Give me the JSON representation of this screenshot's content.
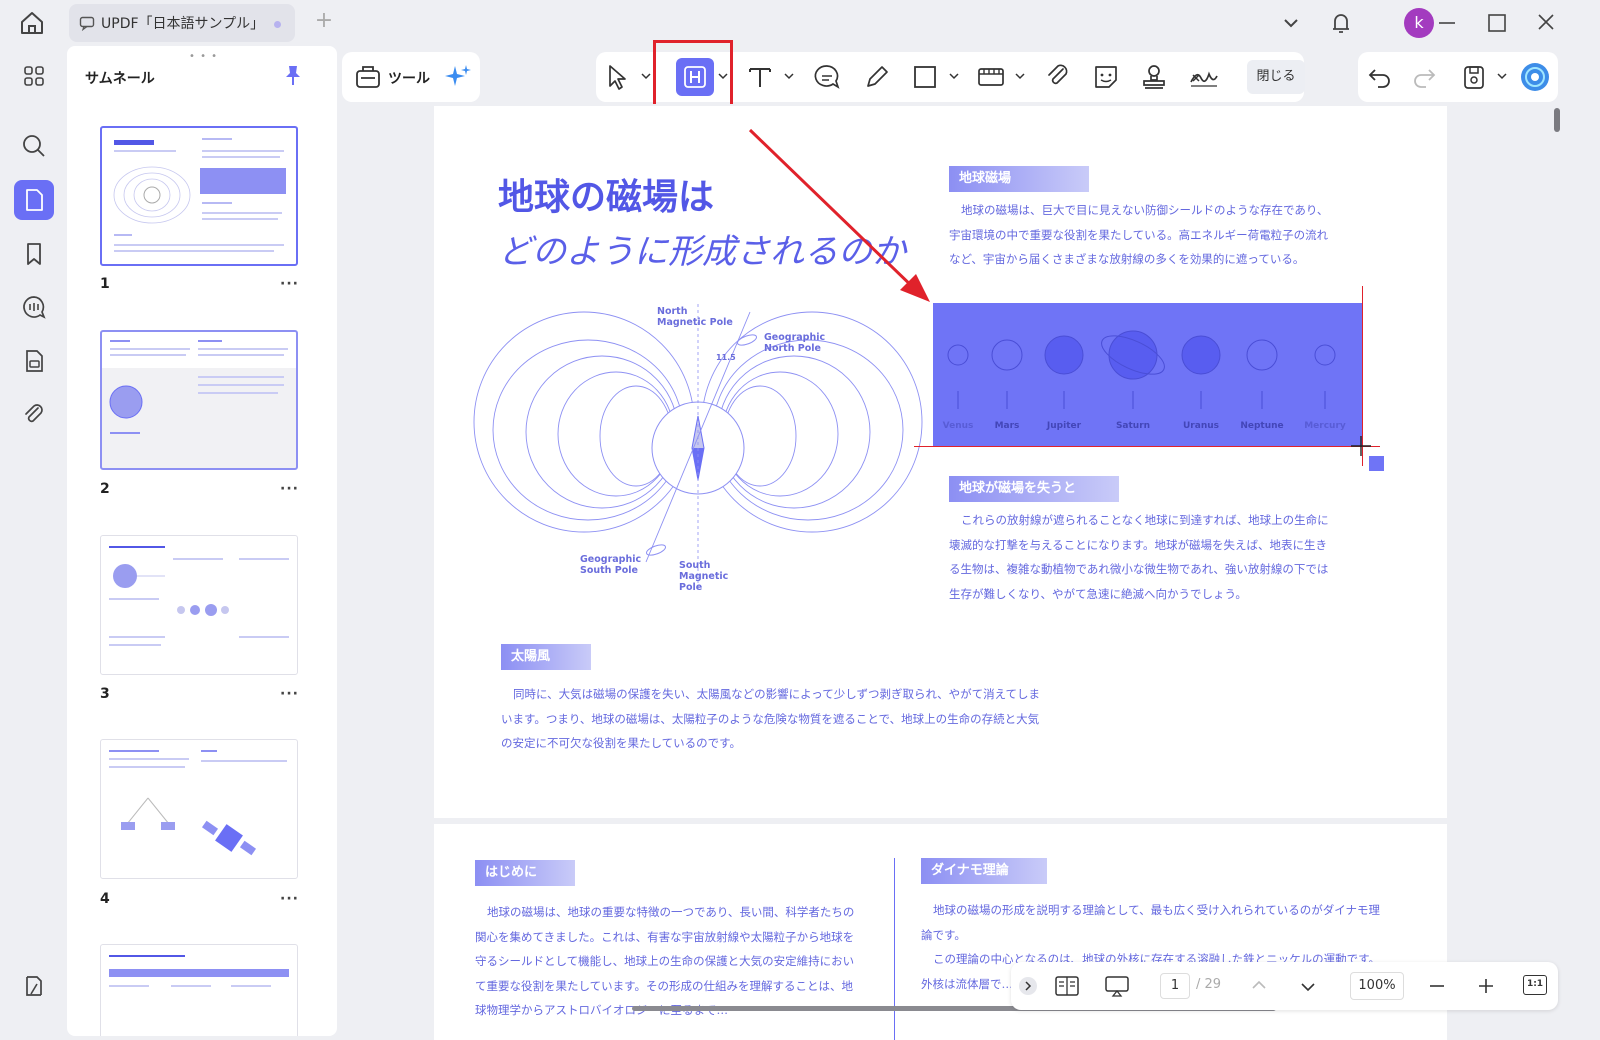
{
  "window": {
    "tab_title": "UPDF「日本語サンプル」",
    "new_tab": "+",
    "avatar_initial": "k"
  },
  "thumbnails": {
    "title": "サムネール",
    "grip": "• • •",
    "more": "···",
    "pages": [
      {
        "number": "1"
      },
      {
        "number": "2"
      },
      {
        "number": "3"
      },
      {
        "number": "4"
      }
    ]
  },
  "toolbar": {
    "tools_label": "ツール",
    "close_label": "閉じる",
    "active_tool": "highlight-area",
    "accent_color": "#6a6ff5",
    "annotation_color": "#e0222b"
  },
  "document": {
    "title_line1": "地球の磁場は",
    "title_line2": "どのように形成されるのか",
    "section1": {
      "heading": "地球磁場",
      "lines": [
        "地球の磁場は、巨大で目に見えない防御シールドのような存在であり、",
        "宇宙環境の中で重要な役割を果たしている。高エネルギー荷電粒子の流れ",
        "など、宇宙から届くさまざまな放射線の多くを効果的に遮っている。"
      ]
    },
    "section2": {
      "heading": "地球が磁場を失うと",
      "lines": [
        "これらの放射線が遮られることなく地球に到達すれば、地球上の生命に",
        "壊滅的な打撃を与えることになります。地球が磁場を失えば、地表に生き",
        "る生物は、複雑な動植物であれ微小な微生物であれ、強い放射線の下では",
        "生存が難しくなり、やがて急速に絶滅へ向かうでしょう。"
      ]
    },
    "section3": {
      "heading": "太陽風",
      "lines": [
        "同時に、大気は磁場の保護を失い、太陽風などの影響によって少しずつ剥ぎ取られ、やがて消えてしま",
        "います。つまり、地球の磁場は、太陽粒子のような危険な物質を遮ることで、地球上の生命の存続と大気",
        "の安定に不可欠な役割を果たしているのです。"
      ]
    },
    "planets": [
      "Venus",
      "Mars",
      "Jupiter",
      "Saturn",
      "Uranus",
      "Neptune",
      "Mercury"
    ],
    "diagram_labels": {
      "north_magnetic": "North\nMagnetic Pole",
      "geo_north": "Geographic\nNorth Pole",
      "geo_south": "Geographic\nSouth Pole",
      "south_magnetic": "South\nMagnetic\nPole",
      "angle": "11.5"
    },
    "page2": {
      "left_heading": "はじめに",
      "left_lines": [
        "地球の磁場は、地球の重要な特徴の一つであり、長い間、科学者たちの",
        "関心を集めてきました。これは、有害な宇宙放射線や太陽粒子から地球を",
        "守るシールドとして機能し、地球上の生命の保護と大気の安定維持におい",
        "て重要な役割を果たしています。その形成の仕組みを理解することは、地",
        "球物理学からアストロバイオロジーに至るまで…"
      ],
      "right_heading": "ダイナモ理論",
      "right_lines": [
        "地球の磁場の形成を説明する理論として、最も広く受け入れられているのがダイナモ理",
        "論です。",
        "この理論の中心となるのは、地球の外核に存在する溶融した鉄とニッケルの運動です。",
        "外核は流体層で…"
      ]
    }
  },
  "status": {
    "current_page": "1",
    "total_pages": "/ 29",
    "zoom": "100%",
    "fit_label": "1:1"
  }
}
